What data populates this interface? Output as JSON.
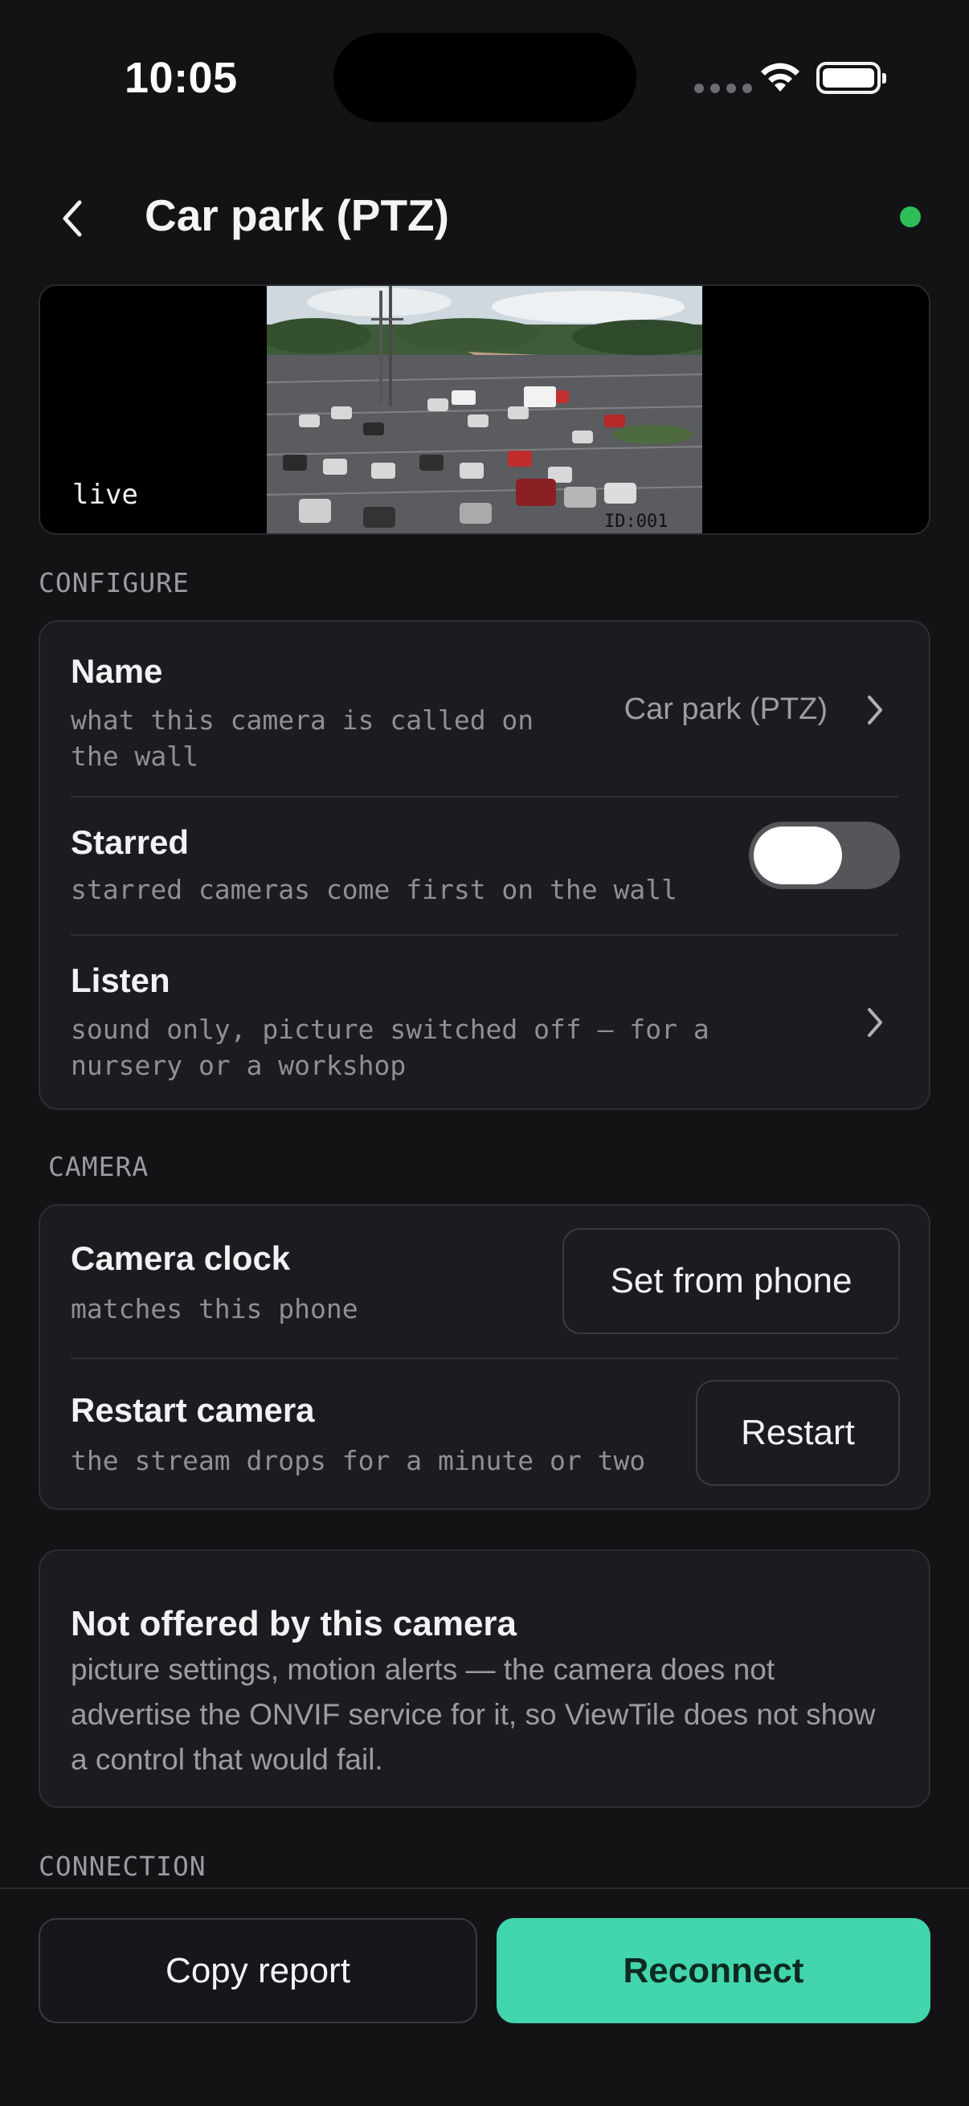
{
  "status_bar": {
    "time": "10:05"
  },
  "header": {
    "title": "Car park (PTZ)",
    "status_color": "#2ebd59"
  },
  "preview": {
    "overlay_label": "live",
    "camera_id_text": "ID:001"
  },
  "configure": {
    "section_label": "CONFIGURE",
    "name_row": {
      "title": "Name",
      "subtitle": "what this camera is called on the wall",
      "value": "Car park (PTZ)"
    },
    "starred_row": {
      "title": "Starred",
      "subtitle": "starred cameras come first on the wall",
      "toggle_on": false
    },
    "listen_row": {
      "title": "Listen",
      "subtitle": "sound only, picture switched off — for a nursery or a workshop"
    }
  },
  "camera": {
    "section_label": "CAMERA",
    "clock_row": {
      "title": "Camera clock",
      "subtitle": "matches this phone",
      "button": "Set from phone"
    },
    "restart_row": {
      "title": "Restart camera",
      "subtitle": "the stream drops for a minute or two",
      "button": "Restart"
    }
  },
  "not_offered": {
    "title": "Not offered by this camera",
    "body": "picture settings, motion alerts — the camera does not advertise the ONVIF service for it, so ViewTile does not show a control that would fail."
  },
  "connection": {
    "section_label": "CONNECTION"
  },
  "bottom_actions": {
    "copy_label": "Copy report",
    "reconnect_label": "Reconnect",
    "accent_color": "#43d5ad"
  }
}
